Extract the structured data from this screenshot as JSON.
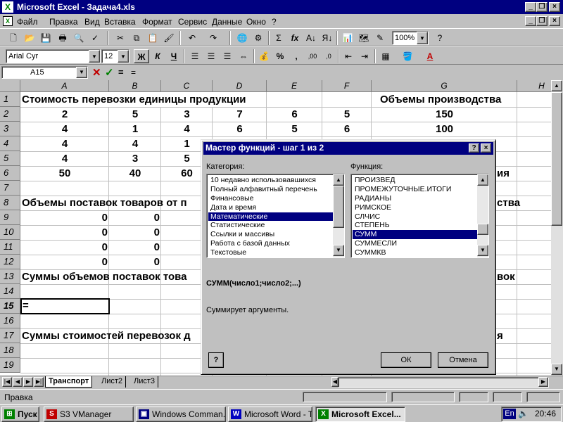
{
  "window": {
    "title": "Microsoft Excel - Задача4.xls"
  },
  "menu": [
    "Файл",
    "Правка",
    "Вид",
    "Вставка",
    "Формат",
    "Сервис",
    "Данные",
    "Окно",
    "?"
  ],
  "toolbar": {
    "zoom": "100%",
    "font": "Arial Cyr",
    "size": "12",
    "bold": "Ж",
    "italic": "К",
    "underline": "Ч",
    "percent": "%",
    "comma": ",",
    "sigma": "Σ",
    "fx": "fx"
  },
  "formula_bar": {
    "cell_ref": "A15",
    "eq": "=",
    "content": "="
  },
  "columns": [
    "A",
    "B",
    "C",
    "D",
    "E",
    "F",
    "G",
    "H"
  ],
  "rows": [
    "1",
    "2",
    "3",
    "4",
    "5",
    "6",
    "7",
    "8",
    "9",
    "10",
    "11",
    "12",
    "13",
    "14",
    "15",
    "16",
    "17",
    "18",
    "19"
  ],
  "sheet": {
    "r1a": "Стоимость перевозки единицы продукции",
    "r1g": "Объемы производства",
    "r2": [
      "2",
      "5",
      "3",
      "7",
      "6",
      "5",
      "150"
    ],
    "r3": [
      "4",
      "1",
      "4",
      "6",
      "5",
      "6",
      "100"
    ],
    "r4": [
      "4",
      "4",
      "1"
    ],
    "r5": [
      "4",
      "3",
      "5"
    ],
    "r6": [
      "50",
      "40",
      "60"
    ],
    "r6g": "ия",
    "r8a": "Объемы поставок товаров от п",
    "r8g": "ства",
    "r9": [
      "0",
      "0"
    ],
    "r10": [
      "0",
      "0"
    ],
    "r11": [
      "0",
      "0"
    ],
    "r12": [
      "0",
      "0"
    ],
    "r13a": "Суммы объемов поставок това",
    "r13g": "вок",
    "r15a": "=",
    "r17a": "Суммы стоимостей перевозок д",
    "r17g": "я"
  },
  "sheet_tabs": [
    "Транспорт",
    "Лист2",
    "Лист3"
  ],
  "status": {
    "text": "Правка"
  },
  "dialog": {
    "title": "Мастер функций - шаг 1 из 2",
    "category_label": "Категория:",
    "function_label": "Функция:",
    "categories": [
      "10 недавно использовавшихся",
      "Полный алфавитный перечень",
      "Финансовые",
      "Дата и время",
      "Математические",
      "Статистические",
      "Ссылки и массивы",
      "Работа с базой данных",
      "Текстовые"
    ],
    "selected_category": 4,
    "functions": [
      "ПРОИЗВЕД",
      "ПРОМЕЖУТОЧНЫЕ.ИТОГИ",
      "РАДИАНЫ",
      "РИМСКОЕ",
      "СЛЧИС",
      "СТЕПЕНЬ",
      "СУММ",
      "СУММЕСЛИ",
      "СУММКВ"
    ],
    "selected_function": 6,
    "signature": "СУММ(число1;число2;...)",
    "description": "Суммирует аргументы.",
    "help": "?",
    "ok": "ОК",
    "cancel": "Отмена"
  },
  "taskbar": {
    "start": "Пуск",
    "items": [
      "S3 VManager",
      "Windows Comman...",
      "Microsoft Word - T...",
      "Microsoft Excel..."
    ],
    "lang": "En",
    "time": "20:46"
  }
}
